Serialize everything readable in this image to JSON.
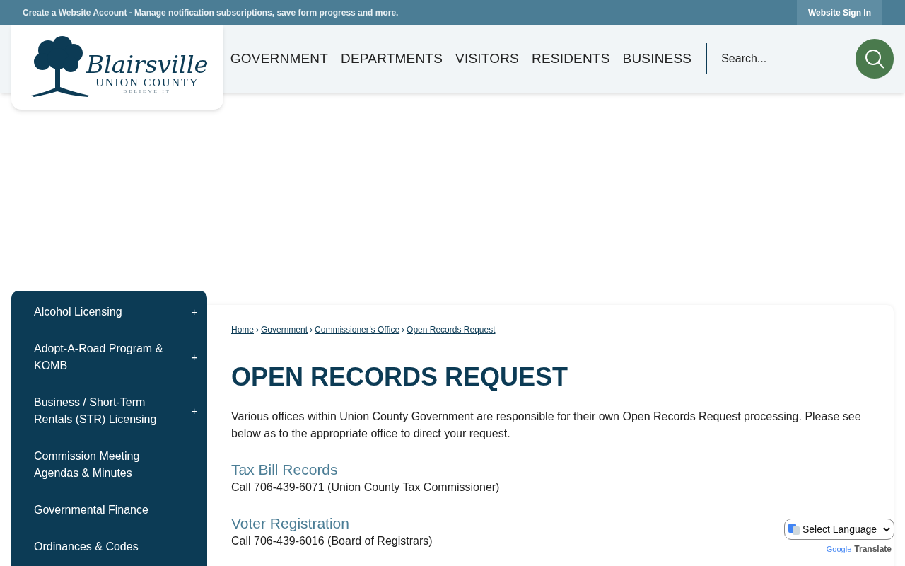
{
  "top_bar": {
    "message": "Create a Website Account - Manage notification subscriptions, save form progress and more.",
    "sign_in": "Website Sign In"
  },
  "logo": {
    "script": "Blairsville",
    "county": "UNION COUNTY",
    "tagline": "BELIEVE IT"
  },
  "nav": [
    "GOVERNMENT",
    "DEPARTMENTS",
    "VISITORS",
    "RESIDENTS",
    "BUSINESS"
  ],
  "search": {
    "placeholder": "Search..."
  },
  "sidebar": [
    {
      "label": "Alcohol Licensing",
      "expandable": true
    },
    {
      "label": "Adopt-A-Road Program & KOMB",
      "expandable": true
    },
    {
      "label": "Business / Short-Term Rentals (STR) Licensing",
      "expandable": true
    },
    {
      "label": "Commission Meeting Agendas & Minutes",
      "expandable": false
    },
    {
      "label": "Governmental Finance",
      "expandable": false
    },
    {
      "label": "Ordinances & Codes",
      "expandable": false
    }
  ],
  "expand_glyph": "+",
  "breadcrumb": [
    "Home",
    "Government",
    "Commissioner’s Office",
    "Open Records Request"
  ],
  "breadcrumb_separator": "›",
  "title": "OPEN RECORDS REQUEST",
  "intro": "Various offices within Union County Government are responsible for their own Open Records Request processing. Please see below as to the appropriate office to direct your request.",
  "sections": [
    {
      "heading": "Tax Bill Records",
      "text": "Call 706-439-6071 (Union County Tax Commissioner)"
    },
    {
      "heading": "Voter Registration",
      "text": "Call 706-439-6016 (Board of Registrars)"
    }
  ],
  "translate": {
    "select": "Select Language",
    "powered_by": "Google",
    "label": "Translate"
  }
}
